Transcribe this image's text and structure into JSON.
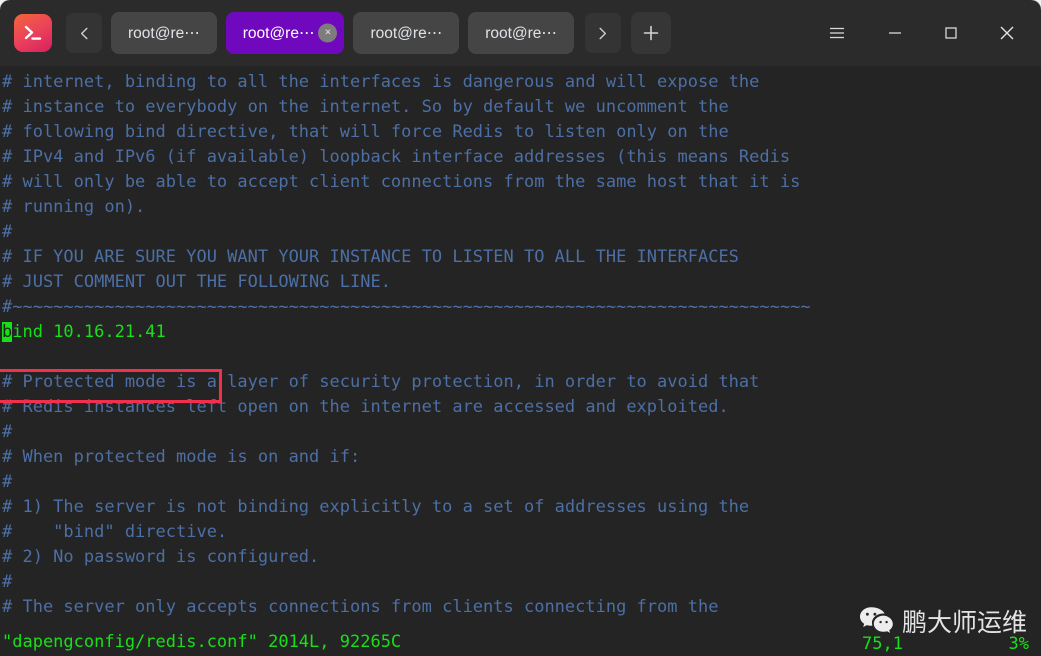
{
  "window": {
    "app_icon": "terminal-prompt-icon",
    "colors": {
      "titlebar_bg": "#2b2b2b",
      "terminal_bg": "#242424",
      "active_tab": "#7009bd",
      "comment_text": "#4c6fa5",
      "green_text": "#18e018",
      "annotation": "#f2304e"
    }
  },
  "titlebar": {
    "nav_prev_icon": "chevron-left-icon",
    "nav_next_icon": "chevron-right-icon",
    "new_tab_icon": "plus-icon",
    "menu_icon": "hamburger-menu-icon",
    "minimize_icon": "minimize-icon",
    "maximize_icon": "maximize-icon",
    "close_icon": "close-icon",
    "tabs": [
      {
        "label": "root@re⋯",
        "active": false
      },
      {
        "label": "root@re⋯",
        "active": true,
        "close_label": "×"
      },
      {
        "label": "root@re⋯",
        "active": false
      },
      {
        "label": "root@re⋯",
        "active": false
      }
    ]
  },
  "terminal": {
    "lines": [
      {
        "text": "# internet, binding to all the interfaces is dangerous and will expose the",
        "style": "comment"
      },
      {
        "text": "# instance to everybody on the internet. So by default we uncomment the",
        "style": "comment"
      },
      {
        "text": "# following bind directive, that will force Redis to listen only on the",
        "style": "comment"
      },
      {
        "text": "# IPv4 and IPv6 (if available) loopback interface addresses (this means Redis",
        "style": "comment"
      },
      {
        "text": "# will only be able to accept client connections from the same host that it is",
        "style": "comment"
      },
      {
        "text": "# running on).",
        "style": "comment"
      },
      {
        "text": "#",
        "style": "comment"
      },
      {
        "text": "# IF YOU ARE SURE YOU WANT YOUR INSTANCE TO LISTEN TO ALL THE INTERFACES",
        "style": "comment"
      },
      {
        "text": "# JUST COMMENT OUT THE FOLLOWING LINE.",
        "style": "comment"
      },
      {
        "text": "#~~~~~~~~~~~~~~~~~~~~~~~~~~~~~~~~~~~~~~~~~~~~~~~~~~~~~~~~~~~~~~~~~~~~~~~~~~~~~~",
        "style": "comment"
      },
      {
        "text": "bind 10.16.21.41",
        "style": "green",
        "cursor_at": 0
      },
      {
        "text": "",
        "style": "comment"
      },
      {
        "text": "# Protected mode is a layer of security protection, in order to avoid that",
        "style": "comment"
      },
      {
        "text": "# Redis instances left open on the internet are accessed and exploited.",
        "style": "comment"
      },
      {
        "text": "#",
        "style": "comment"
      },
      {
        "text": "# When protected mode is on and if:",
        "style": "comment"
      },
      {
        "text": "#",
        "style": "comment"
      },
      {
        "text": "# 1) The server is not binding explicitly to a set of addresses using the",
        "style": "comment"
      },
      {
        "text": "#    \"bind\" directive.",
        "style": "comment"
      },
      {
        "text": "# 2) No password is configured.",
        "style": "comment"
      },
      {
        "text": "#",
        "style": "comment"
      },
      {
        "text": "# The server only accepts connections from clients connecting from the",
        "style": "comment"
      }
    ]
  },
  "statusbar": {
    "file_info": "\"dapengconfig/redis.conf\" 2014L, 92265C",
    "cursor_position": "75,1",
    "scroll_percent": "3%"
  },
  "watermark": {
    "icon": "wechat-logo-icon",
    "text": "鹏大师运维"
  }
}
